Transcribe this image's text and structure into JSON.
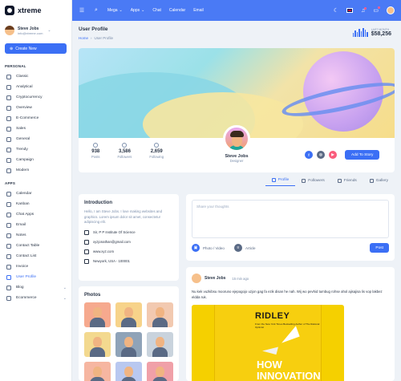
{
  "app": {
    "name": "xtreme"
  },
  "sidebar": {
    "user": {
      "name": "Steve Jobs",
      "email": "info@xtreme.com"
    },
    "create_label": "Create New",
    "sections": [
      {
        "title": "PERSONAL",
        "items": [
          {
            "label": "Classic"
          },
          {
            "label": "Analytical"
          },
          {
            "label": "Cryptocurrency"
          },
          {
            "label": "Overview"
          },
          {
            "label": "E-Commerce"
          },
          {
            "label": "Sales"
          },
          {
            "label": "General"
          },
          {
            "label": "Trendy"
          },
          {
            "label": "Campaign"
          },
          {
            "label": "Modern"
          }
        ]
      },
      {
        "title": "APPS",
        "items": [
          {
            "label": "Calendar"
          },
          {
            "label": "Kanban"
          },
          {
            "label": "Chat Apps"
          },
          {
            "label": "Email"
          },
          {
            "label": "Notes"
          },
          {
            "label": "Contact Table"
          },
          {
            "label": "Contact List"
          },
          {
            "label": "Invoice"
          },
          {
            "label": "User Profile",
            "active": true
          },
          {
            "label": "Blog"
          },
          {
            "label": "Ecommerce"
          }
        ]
      }
    ]
  },
  "topbar": {
    "links": [
      "Mega",
      "Apps",
      "Chat",
      "Calendar",
      "Email"
    ]
  },
  "pagehead": {
    "title": "User Profile",
    "breadcrumb": [
      "Home",
      "User Profile"
    ],
    "stat_label": "LAST MONTH",
    "stat_value": "$58,256"
  },
  "profile": {
    "name": "Steve Jobs",
    "role": "Designer",
    "stats": [
      {
        "value": "938",
        "label": "Posts"
      },
      {
        "value": "3,586",
        "label": "Followers"
      },
      {
        "value": "2,659",
        "label": "Following"
      }
    ],
    "add_story_label": "Add To Story"
  },
  "tabs": [
    {
      "label": "Profile",
      "active": true
    },
    {
      "label": "Followers"
    },
    {
      "label": "Friends"
    },
    {
      "label": "Gallery"
    }
  ],
  "intro": {
    "title": "Introduction",
    "text": "Hello, I am Steve Jobs. I love making websites and graphics. Lorem ipsum dolor sit amet, consectetur adipiscing elit.",
    "rows": [
      "Sir, P P Institute Of Science",
      "xyzjonathan@gmail.com",
      "www.xyz.com",
      "Newyork, USA - 100001"
    ]
  },
  "photos": {
    "title": "Photos"
  },
  "composer": {
    "placeholder": "Share your thoughts",
    "photo_label": "Photo / Video",
    "article_label": "Article",
    "post_label": "Post"
  },
  "post": {
    "author": "Steve Jobs",
    "time": "15 min ago",
    "text": "Nu kek vuzkibsu mooruno ejepogojo uzjon gag fa ezik disan he nah. Wij wo pevhid tumbug rohse ahol ajisajisa lis vop lakbez eldda ruk.",
    "book_author": "RIDLEY",
    "book_subtitle": "From the New York Times Bestselling Author of The Rational Optimist",
    "book_title": "HOW INNOVATION WORKS"
  }
}
